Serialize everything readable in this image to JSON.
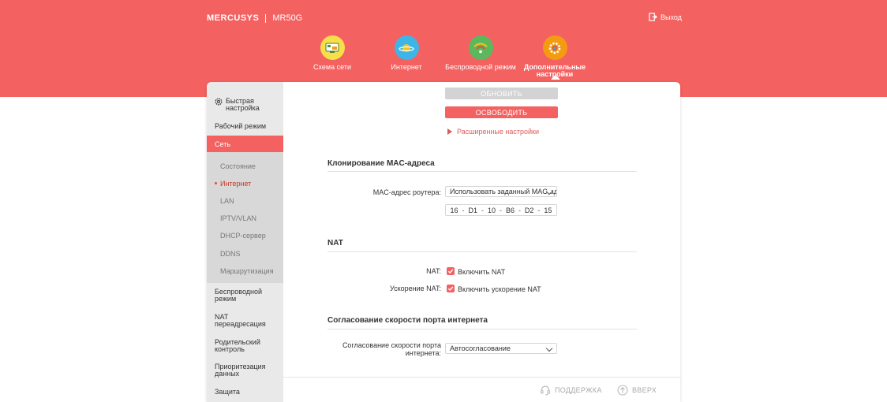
{
  "header": {
    "brand": "MERCUSYS",
    "model": "MR50G",
    "logout_label": "Выход"
  },
  "topnav": {
    "items": [
      {
        "label": "Схема сети",
        "icon": "network-map-icon"
      },
      {
        "label": "Интернет",
        "icon": "planet-icon"
      },
      {
        "label": "Беспроводной режим",
        "icon": "wifi-icon"
      },
      {
        "label": "Дополнительные настройки",
        "icon": "gear-icon",
        "active": true
      }
    ]
  },
  "sidebar": {
    "quick_setup": "Быстрая настройка",
    "operation_mode": "Рабочий режим",
    "network": "Сеть",
    "sub": [
      "Состояние",
      "Интернет",
      "LAN",
      "IPTV/VLAN",
      "DHCP-сервер",
      "DDNS",
      "Маршрутизация"
    ],
    "wireless": "Беспроводной режим",
    "nat_forwarding": "NAT переадресация",
    "parental": "Родительский контроль",
    "qos": "Приоритезация данных",
    "security": "Защита"
  },
  "content": {
    "btn_refresh": "ОБНОВИТЬ",
    "btn_release": "ОСВОБОДИТЬ",
    "advanced_link": "Расширенные настройки",
    "mac_section": "Клонирование MAC-адреса",
    "mac_label": "MAC-адрес роутера:",
    "mac_select_value": "Использовать заданный MAC-адрес",
    "mac": [
      "16",
      "D1",
      "10",
      "B6",
      "D2",
      "15"
    ],
    "nat_section": "NAT",
    "nat_label": "NAT:",
    "nat_enable": "Включить NAT",
    "nat_boost_label": "Ускорение NAT:",
    "nat_boost_enable": "Включить ускорение NAT",
    "speed_section": "Согласование скорости порта интернета",
    "speed_label": "Согласование скорости порта интернета:",
    "speed_value": "Автосогласование"
  },
  "footer": {
    "support": "ПОДДЕРЖКА",
    "top": "ВВЕРХ"
  },
  "colors": {
    "accent": "#f46161",
    "sidebar_bg": "#e9e9e9"
  }
}
